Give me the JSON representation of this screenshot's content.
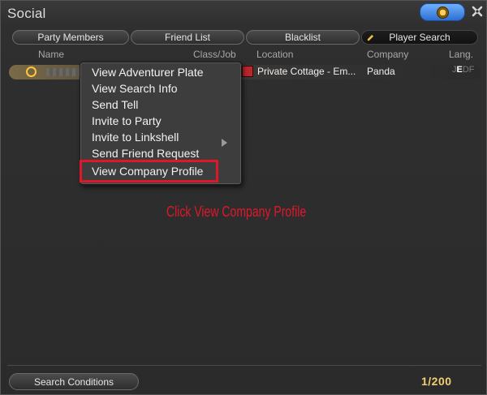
{
  "window": {
    "title": "Social"
  },
  "tabs": [
    {
      "label": "Party Members",
      "active": false
    },
    {
      "label": "Friend List",
      "active": false
    },
    {
      "label": "Blacklist",
      "active": false
    },
    {
      "label": "Player Search",
      "active": true
    }
  ],
  "columns": {
    "name": "Name",
    "class_job": "Class/Job",
    "location": "Location",
    "company": "Company",
    "lang": "Lang."
  },
  "result_row": {
    "location": "Private Cottage - Em...",
    "company": "Panda",
    "lang_letters": [
      "J",
      "E",
      "D",
      "F"
    ],
    "lang_active": "E"
  },
  "context_menu": {
    "items": [
      {
        "label": "View Adventurer Plate"
      },
      {
        "label": "View Search Info"
      },
      {
        "label": "Send Tell"
      },
      {
        "label": "Invite to Party"
      },
      {
        "label": "Invite to Linkshell",
        "has_submenu": true
      },
      {
        "label": "Send Friend Request"
      },
      {
        "label": "View Company Profile",
        "highlighted": true
      }
    ]
  },
  "annotation": {
    "text": "Click View Company Profile",
    "color": "#e0172a"
  },
  "footer": {
    "search_conditions_label": "Search Conditions",
    "page_counter": "1/200"
  },
  "icons": {
    "title_badge": "company-crest-icon",
    "close": "close-icon",
    "status": "online-status-icon",
    "housing": "house-icon"
  }
}
